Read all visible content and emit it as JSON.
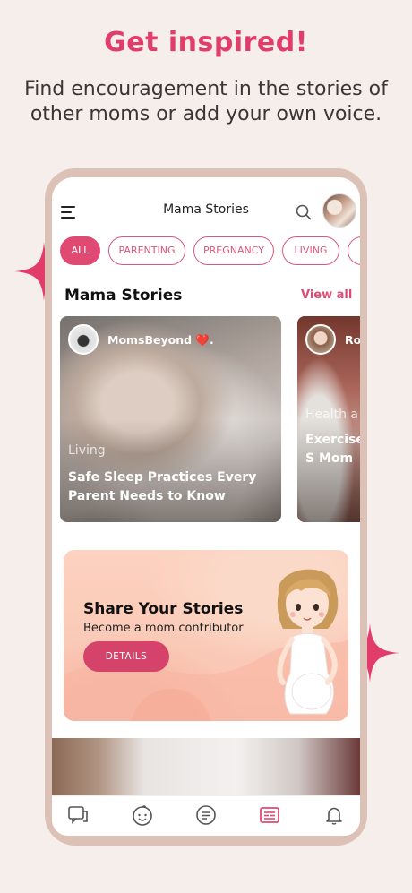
{
  "headline": "Get inspired!",
  "subheadline": "Find encouragement in the stories of other moms or add your own voice.",
  "colors": {
    "accent": "#e23c6b",
    "frame": "#dcc2b6",
    "background": "#f5eeeb"
  },
  "app": {
    "title": "Mama Stories",
    "icons": {
      "menu": "menu-icon",
      "search": "search-icon",
      "avatar": "profile-avatar"
    }
  },
  "filters": [
    {
      "label": "ALL",
      "active": true
    },
    {
      "label": "PARENTING",
      "active": false
    },
    {
      "label": "PREGNANCY",
      "active": false
    },
    {
      "label": "LIVING",
      "active": false
    },
    {
      "label": "",
      "active": false
    }
  ],
  "section": {
    "title": "Mama Stories",
    "view_all": "View all"
  },
  "stories": [
    {
      "author": "MomsBeyond ❤️.",
      "category": "Living",
      "title": "Safe Sleep Practices Every Parent Needs to Know"
    },
    {
      "author": "Ro",
      "category": "Health a",
      "title": "Exercise Nutritio How to S Mom"
    }
  ],
  "promo": {
    "title": "Share Your Stories",
    "subtitle": "Become a mom contributor",
    "button": "DETAILS"
  },
  "tabs": [
    {
      "name": "chat-icon",
      "active": false
    },
    {
      "name": "baby-face-icon",
      "active": false
    },
    {
      "name": "message-icon",
      "active": false
    },
    {
      "name": "stories-icon",
      "active": true
    },
    {
      "name": "bell-icon",
      "active": false
    }
  ]
}
